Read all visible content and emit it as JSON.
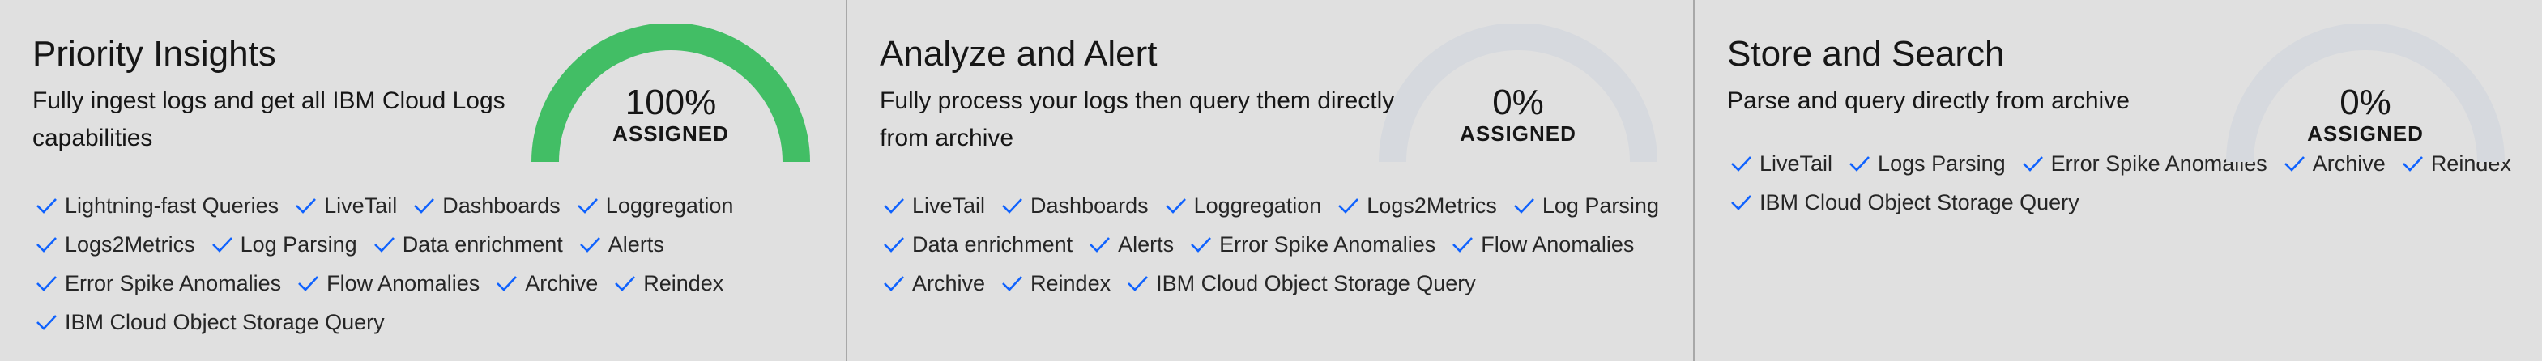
{
  "cards": [
    {
      "title": "Priority Insights",
      "description": "Fully ingest logs and get all IBM Cloud Logs capabilities",
      "percent_value": 100,
      "percent_label": "100%",
      "assigned_label": "ASSIGNED",
      "features": [
        "Lightning-fast Queries",
        "LiveTail",
        "Dashboards",
        "Loggregation",
        "Logs2Metrics",
        "Log Parsing",
        "Data enrichment",
        "Alerts",
        "Error Spike Anomalies",
        "Flow Anomalies",
        "Archive",
        "Reindex",
        "IBM Cloud Object Storage Query"
      ]
    },
    {
      "title": "Analyze and Alert",
      "description": "Fully process your logs then query them directly from archive",
      "percent_value": 0,
      "percent_label": "0%",
      "assigned_label": "ASSIGNED",
      "features": [
        "LiveTail",
        "Dashboards",
        "Loggregation",
        "Logs2Metrics",
        "Log Parsing",
        "Data enrichment",
        "Alerts",
        "Error Spike Anomalies",
        "Flow Anomalies",
        "Archive",
        "Reindex",
        "IBM Cloud Object Storage Query"
      ]
    },
    {
      "title": "Store and Search",
      "description": "Parse and query directly from archive",
      "percent_value": 0,
      "percent_label": "0%",
      "assigned_label": "ASSIGNED",
      "features": [
        "LiveTail",
        "Logs Parsing",
        "Error Spike Anomalies",
        "Archive",
        "Reindex",
        "IBM Cloud Object Storage Query"
      ]
    }
  ],
  "colors": {
    "gauge_fill": "#42be65",
    "gauge_track": "#d6d9de",
    "check": "#0f62fe"
  },
  "icons": {
    "feature_check": "checkmark-icon"
  }
}
